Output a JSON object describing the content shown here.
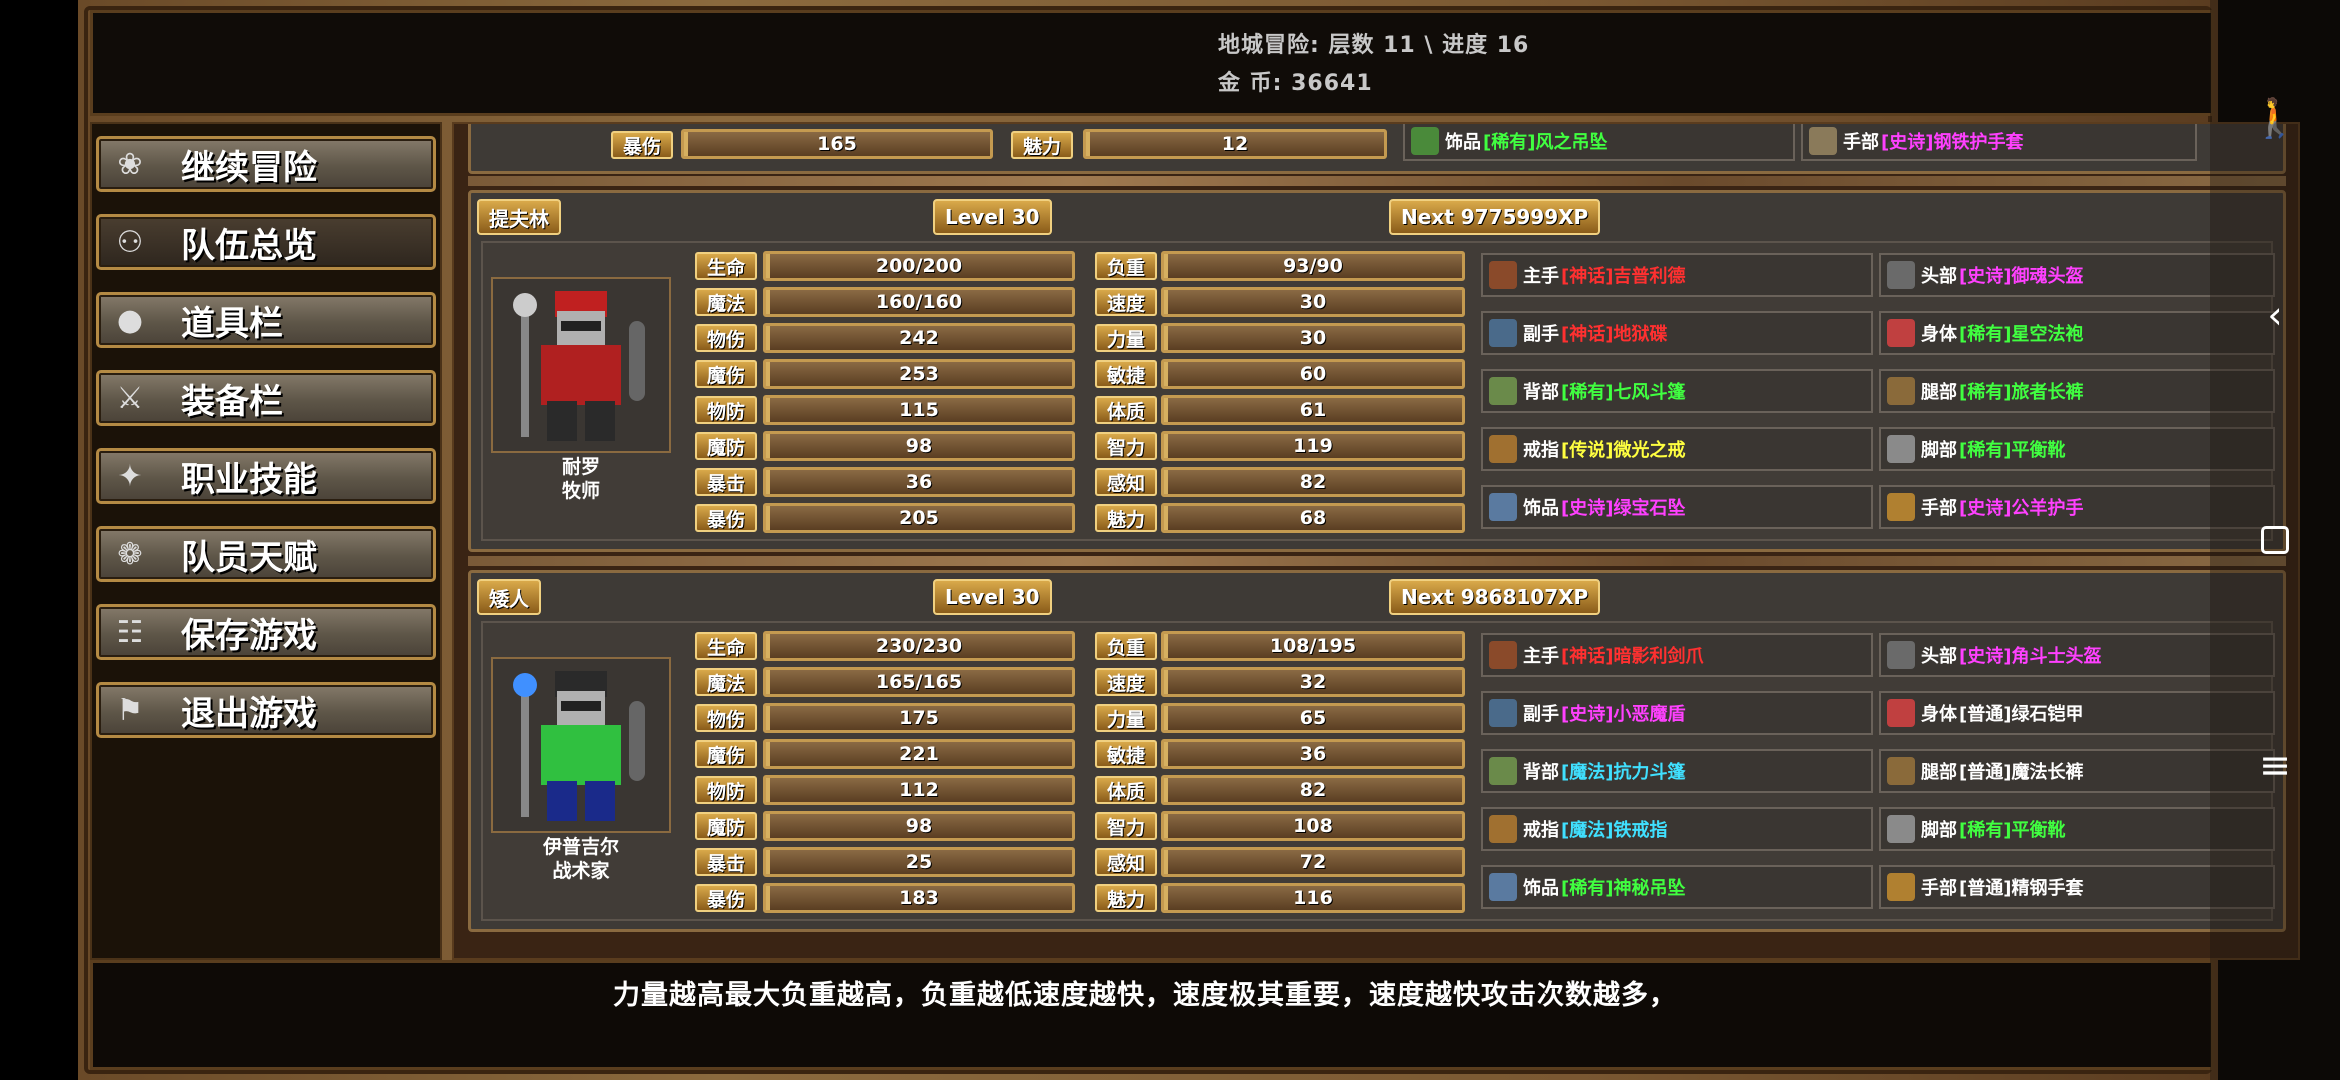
{
  "header": {
    "dungeon": "地城冒险: 层数 11 \\ 进度 16",
    "gold": "金      币: 36641"
  },
  "menu": [
    {
      "label": "继续冒险",
      "icon": "dragon-icon"
    },
    {
      "label": "队伍总览",
      "icon": "party-icon"
    },
    {
      "label": "道具栏",
      "icon": "bag-icon"
    },
    {
      "label": "装备栏",
      "icon": "equipment-icon"
    },
    {
      "label": "职业技能",
      "icon": "skill-icon"
    },
    {
      "label": "队员天赋",
      "icon": "talent-icon"
    },
    {
      "label": "保存游戏",
      "icon": "scroll-icon"
    },
    {
      "label": "退出游戏",
      "icon": "flag-icon"
    }
  ],
  "partial": {
    "l1": "暴伤",
    "v1": "165",
    "l2": "魅力",
    "v2": "12",
    "e1": "饰品",
    "e1q": "[稀有]",
    "e1n": "风之吊坠",
    "e2": "手部",
    "e2q": "[史诗]",
    "e2n": "钢铁护手套"
  },
  "members": [
    {
      "tag": "提夫林",
      "level": "Level 30",
      "next": "Next 9775999XP",
      "name": "耐罗",
      "cls": "牧师",
      "stats": [
        [
          "生命",
          "200/200",
          "负重",
          "93/90"
        ],
        [
          "魔法",
          "160/160",
          "速度",
          "30"
        ],
        [
          "物伤",
          "242",
          "力量",
          "30"
        ],
        [
          "魔伤",
          "253",
          "敏捷",
          "60"
        ],
        [
          "物防",
          "115",
          "体质",
          "61"
        ],
        [
          "魔防",
          "98",
          "智力",
          "119"
        ],
        [
          "暴击",
          "36",
          "感知",
          "82"
        ],
        [
          "暴伤",
          "205",
          "魅力",
          "68"
        ]
      ],
      "equip": [
        [
          "主手",
          "[神话]",
          "吉普利德",
          "#ff3030",
          "头部",
          "[史诗]",
          "御魂头盔",
          "#ff40ff"
        ],
        [
          "副手",
          "[神话]",
          "地狱碟",
          "#ff3030",
          "身体",
          "[稀有]",
          "星空法袍",
          "#40ff40"
        ],
        [
          "背部",
          "[稀有]",
          "七风斗篷",
          "#40ff40",
          "腿部",
          "[稀有]",
          "旅者长裤",
          "#40ff40"
        ],
        [
          "戒指",
          "[传说]",
          "微光之戒",
          "#ffff40",
          "脚部",
          "[稀有]",
          "平衡靴",
          "#40ff40"
        ],
        [
          "饰品",
          "[史诗]",
          "绿宝石坠",
          "#ff40ff",
          "手部",
          "[史诗]",
          "公羊护手",
          "#ff40ff"
        ]
      ]
    },
    {
      "tag": "矮人",
      "level": "Level 30",
      "next": "Next 9868107XP",
      "name": "伊普吉尔",
      "cls": "战术家",
      "stats": [
        [
          "生命",
          "230/230",
          "负重",
          "108/195"
        ],
        [
          "魔法",
          "165/165",
          "速度",
          "32"
        ],
        [
          "物伤",
          "175",
          "力量",
          "65"
        ],
        [
          "魔伤",
          "221",
          "敏捷",
          "36"
        ],
        [
          "物防",
          "112",
          "体质",
          "82"
        ],
        [
          "魔防",
          "98",
          "智力",
          "108"
        ],
        [
          "暴击",
          "25",
          "感知",
          "72"
        ],
        [
          "暴伤",
          "183",
          "魅力",
          "116"
        ]
      ],
      "equip": [
        [
          "主手",
          "[神话]",
          "暗影利剑爪",
          "#ff3030",
          "头部",
          "[史诗]",
          "角斗士头盔",
          "#ff40ff"
        ],
        [
          "副手",
          "[史诗]",
          "小恶魔盾",
          "#ff40ff",
          "身体",
          "[普通]",
          "绿石铠甲",
          "#ffffff"
        ],
        [
          "背部",
          "[魔法]",
          "抗力斗篷",
          "#40e0ff",
          "腿部",
          "[普通]",
          "魔法长裤",
          "#ffffff"
        ],
        [
          "戒指",
          "[魔法]",
          "铁戒指",
          "#40e0ff",
          "脚部",
          "[稀有]",
          "平衡靴",
          "#40ff40"
        ],
        [
          "饰品",
          "[稀有]",
          "神秘吊坠",
          "#40ff40",
          "手部",
          "[普通]",
          "精钢手套",
          "#ffffff"
        ]
      ]
    }
  ],
  "hint": "力量越高最大负重越高，负重越低速度越快，速度极其重要，速度越快攻击次数越多，"
}
